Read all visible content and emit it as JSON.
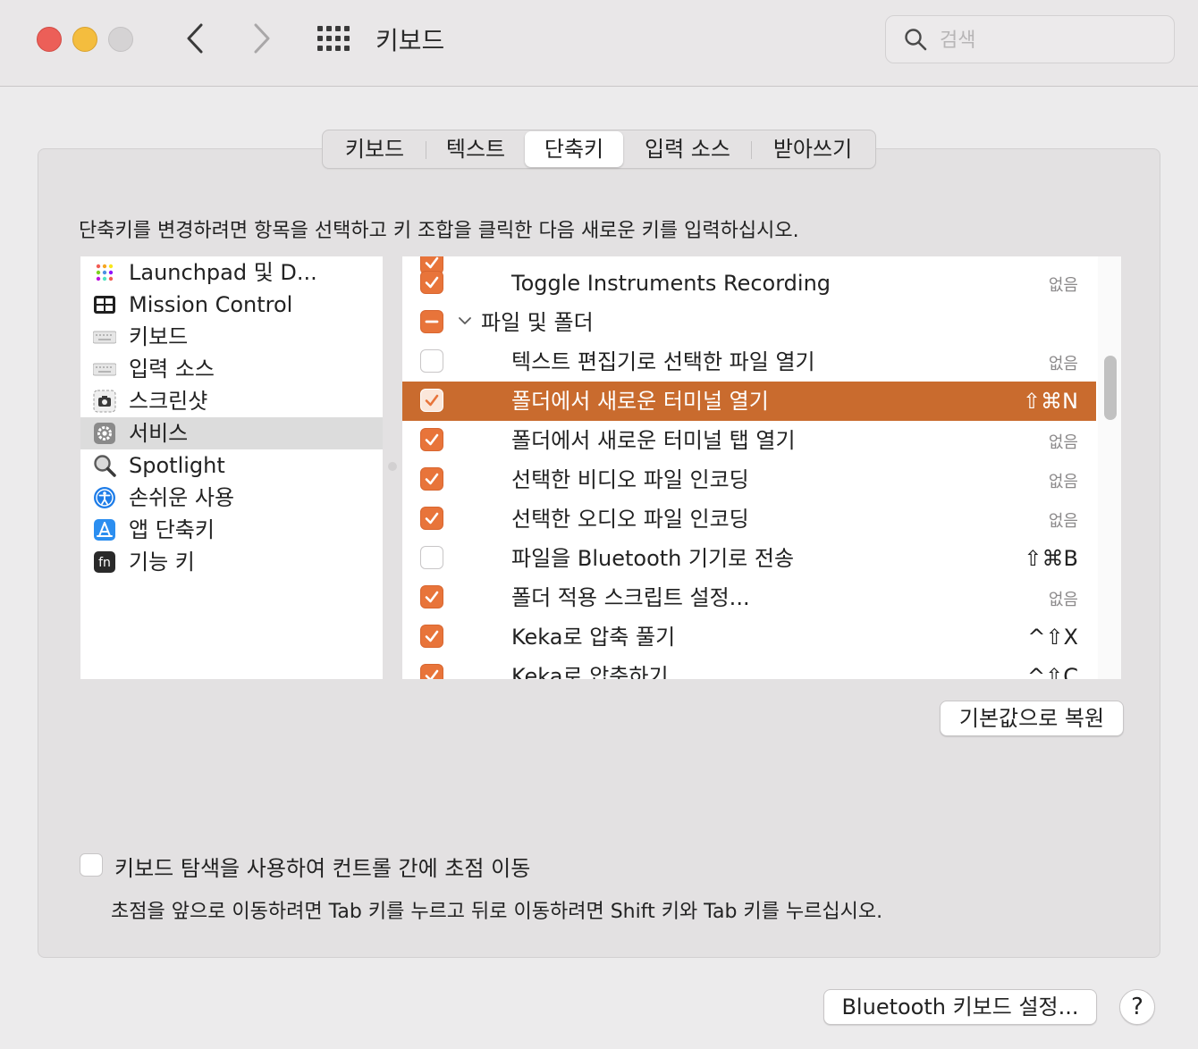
{
  "window": {
    "title": "키보드"
  },
  "search": {
    "placeholder": "검색",
    "value": ""
  },
  "tabs": [
    {
      "label": "키보드",
      "active": false
    },
    {
      "label": "텍스트",
      "active": false
    },
    {
      "label": "단축키",
      "active": true
    },
    {
      "label": "입력 소스",
      "active": false
    },
    {
      "label": "받아쓰기",
      "active": false
    }
  ],
  "instruction": "단축키를 변경하려면 항목을 선택하고 키 조합을 클릭한 다음 새로운 키를 입력하십시오.",
  "categories": [
    {
      "label": "Launchpad 및 D...",
      "icon": "launchpad-icon"
    },
    {
      "label": "Mission Control",
      "icon": "mission-control-icon"
    },
    {
      "label": "키보드",
      "icon": "keyboard-icon"
    },
    {
      "label": "입력 소스",
      "icon": "input-source-icon"
    },
    {
      "label": "스크린샷",
      "icon": "screenshot-icon"
    },
    {
      "label": "서비스",
      "icon": "gear-icon",
      "selected": true
    },
    {
      "label": "Spotlight",
      "icon": "spotlight-icon"
    },
    {
      "label": "손쉬운 사용",
      "icon": "accessibility-icon"
    },
    {
      "label": "앱 단축키",
      "icon": "app-shortcuts-icon"
    },
    {
      "label": "기능 키",
      "icon": "fn-key-icon"
    }
  ],
  "shortcuts": [
    {
      "label": "",
      "checked": true,
      "key": "",
      "partial": true
    },
    {
      "label": "Toggle Instruments Recording",
      "checked": true,
      "key": "없음",
      "none": true
    },
    {
      "label": "파일 및 폴더",
      "group": true,
      "state": "mixed",
      "key": ""
    },
    {
      "label": "텍스트 편집기로 선택한 파일 열기",
      "checked": false,
      "key": "없음",
      "none": true
    },
    {
      "label": "폴더에서 새로운 터미널 열기",
      "checked": true,
      "key": "⇧⌘N",
      "selected": true
    },
    {
      "label": "폴더에서 새로운 터미널 탭 열기",
      "checked": true,
      "key": "없음",
      "none": true
    },
    {
      "label": "선택한 비디오 파일 인코딩",
      "checked": true,
      "key": "없음",
      "none": true
    },
    {
      "label": "선택한 오디오 파일 인코딩",
      "checked": true,
      "key": "없음",
      "none": true
    },
    {
      "label": "파일을 Bluetooth 기기로 전송",
      "checked": false,
      "key": "⇧⌘B"
    },
    {
      "label": "폴더 적용 스크립트 설정...",
      "checked": true,
      "key": "없음",
      "none": true
    },
    {
      "label": "Keka로 압축 풀기",
      "checked": true,
      "key": "^⇧X"
    },
    {
      "label": "Keka로 압축하기",
      "checked": true,
      "key": "^⇧C"
    }
  ],
  "buttons": {
    "restore": "기본값으로 복원",
    "bluetooth": "Bluetooth 키보드 설정...",
    "help": "?"
  },
  "full_keyboard": {
    "label": "키보드 탐색을 사용하여 컨트롤 간에 초점 이동",
    "help": "초점을 앞으로 이동하려면 Tab 키를 누르고 뒤로 이동하려면 Shift 키와 Tab 키를 누르십시오.",
    "checked": false
  },
  "colors": {
    "accent": "#e8743a",
    "selection": "#c96b2e"
  }
}
